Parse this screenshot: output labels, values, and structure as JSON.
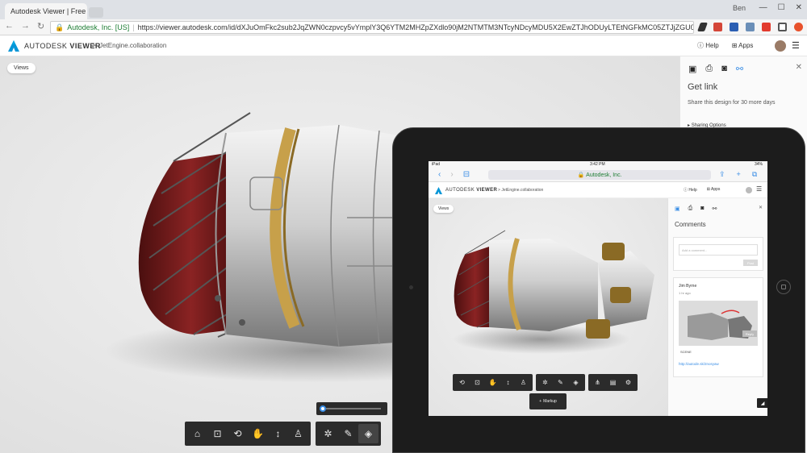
{
  "browser": {
    "tab_title": "Autodesk Viewer | Free",
    "user_label": "Ben",
    "back": "←",
    "forward": "→",
    "reload": "C",
    "secure_label": "Autodesk, Inc. [US]",
    "url": "https://viewer.autodesk.com/id/dXJuOmFkc2sub2JqZWN0czpvcy5vYmplY3Q6YTM2MHZpZXdlo90jM2NTMTM3NTcyNDcyMDU5X2EwZTJhODUyLTEtNGFkMC05ZTJjZGU0YzcyNWMwMy5jb2xsYWJvcmF0aW9u",
    "colors": {
      "tabbar": "#dee1e6",
      "secure": "#1e7e34"
    }
  },
  "header": {
    "brand_prefix": "AUTODESK",
    "brand_name": "VIEWER",
    "breadcrumb_sep": ">",
    "breadcrumb": "JetEngine.collaboration",
    "help_label": "Help",
    "apps_label": "Apps",
    "menu_icon": "☰"
  },
  "viewer": {
    "views_label": "Views",
    "toolbar": {
      "group1": [
        "home-icon",
        "fit-icon",
        "orbit-icon",
        "pan-icon",
        "zoom-icon",
        "walk-icon"
      ],
      "group2": [
        "explode-icon",
        "measure-icon",
        "cube-icon"
      ],
      "glyphs": {
        "home-icon": "⌂",
        "fit-icon": "⊡",
        "orbit-icon": "⟲",
        "pan-icon": "✋",
        "zoom-icon": "↕",
        "walk-icon": "♙",
        "explode-icon": "✲",
        "measure-icon": "✎",
        "cube-icon": "◈"
      }
    },
    "explode_slider": {
      "value": 0.0
    }
  },
  "panel": {
    "tabs": [
      "comment-icon",
      "print-icon",
      "camera-icon",
      "link-icon"
    ],
    "tab_glyphs": [
      "💬",
      "🖶",
      "📷",
      "🔗"
    ],
    "active_tab": 3,
    "title": "Get link",
    "description": "Share this design for 30 more days",
    "sharing_options": "Sharing Options",
    "accent": "#3a8ee6"
  },
  "ipad": {
    "status": {
      "carrier": "iPad",
      "time": "3:42 PM",
      "battery": "34%"
    },
    "safari_url": "Autodesk, Inc.",
    "header": {
      "brand_prefix": "AUTODESK",
      "brand_name": "VIEWER",
      "breadcrumb": "JetEngine.collaboration",
      "help_label": "Help",
      "apps_label": "Apps"
    },
    "views_label": "Views",
    "markup_label": "Markup",
    "panel": {
      "title": "Comments",
      "input_placeholder": "Add a comment...",
      "post_label": "Post",
      "comment": {
        "author": "Jim Byrne",
        "time": "1 hr ago",
        "scene": "SCENE",
        "link": "http://autode.sk/2nosyaw",
        "reply_label": "Reply"
      }
    }
  }
}
